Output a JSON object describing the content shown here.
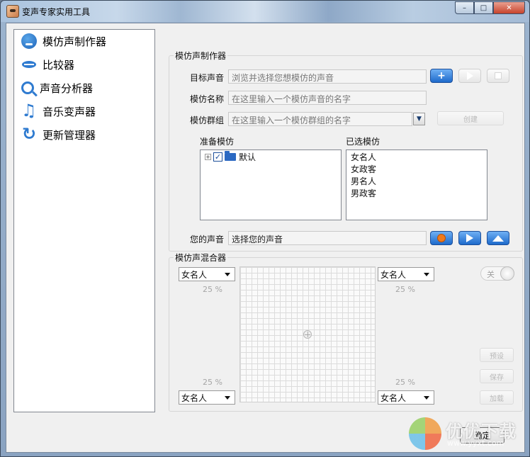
{
  "window": {
    "title": "变声专家实用工具",
    "min": "–",
    "max": "□",
    "close": "✕"
  },
  "nav": {
    "items": [
      {
        "label": "模仿声制作器",
        "icon": "mask-icon"
      },
      {
        "label": "比较器",
        "icon": "lips-icon"
      },
      {
        "label": "声音分析器",
        "icon": "voice-analyzer-icon"
      },
      {
        "label": "音乐变声器",
        "icon": "music-note-icon"
      },
      {
        "label": "更新管理器",
        "icon": "update-icon"
      }
    ]
  },
  "maker": {
    "group_title": "模仿声制作器",
    "target_label": "目标声音",
    "target_placeholder": "浏览并选择您想模仿的声音",
    "name_label": "模仿名称",
    "name_placeholder": "在这里输入一个模仿声音的名字",
    "group_label": "模仿群组",
    "group_placeholder": "在这里输入一个模仿群组的名字",
    "create_btn": "创建",
    "ready_label": "准备模仿",
    "selected_label": "已选模仿",
    "tree_root": "默认",
    "tree_expander": "+",
    "tree_check": "✓",
    "selected_items": [
      "女名人",
      "女政客",
      "男名人",
      "男政客"
    ],
    "your_voice_label": "您的声音",
    "your_voice_value": "选择您的声音"
  },
  "mixer": {
    "group_title": "模仿声混合器",
    "top_left": {
      "value": "女名人",
      "percent": "25 %"
    },
    "top_right": {
      "value": "女名人",
      "percent": "25 %"
    },
    "bottom_left": {
      "value": "女名人",
      "percent": "25 %"
    },
    "bottom_right": {
      "value": "女名人",
      "percent": "25 %"
    },
    "toggle_label": "关",
    "buttons": [
      "预设",
      "保存",
      "加载"
    ]
  },
  "footer": {
    "ok_label": "确定"
  },
  "watermark": {
    "text": "优优下载",
    "url": "www.yyxt.com"
  },
  "colors": {
    "accent": "#1e6acb",
    "record": "#f07a1c"
  }
}
